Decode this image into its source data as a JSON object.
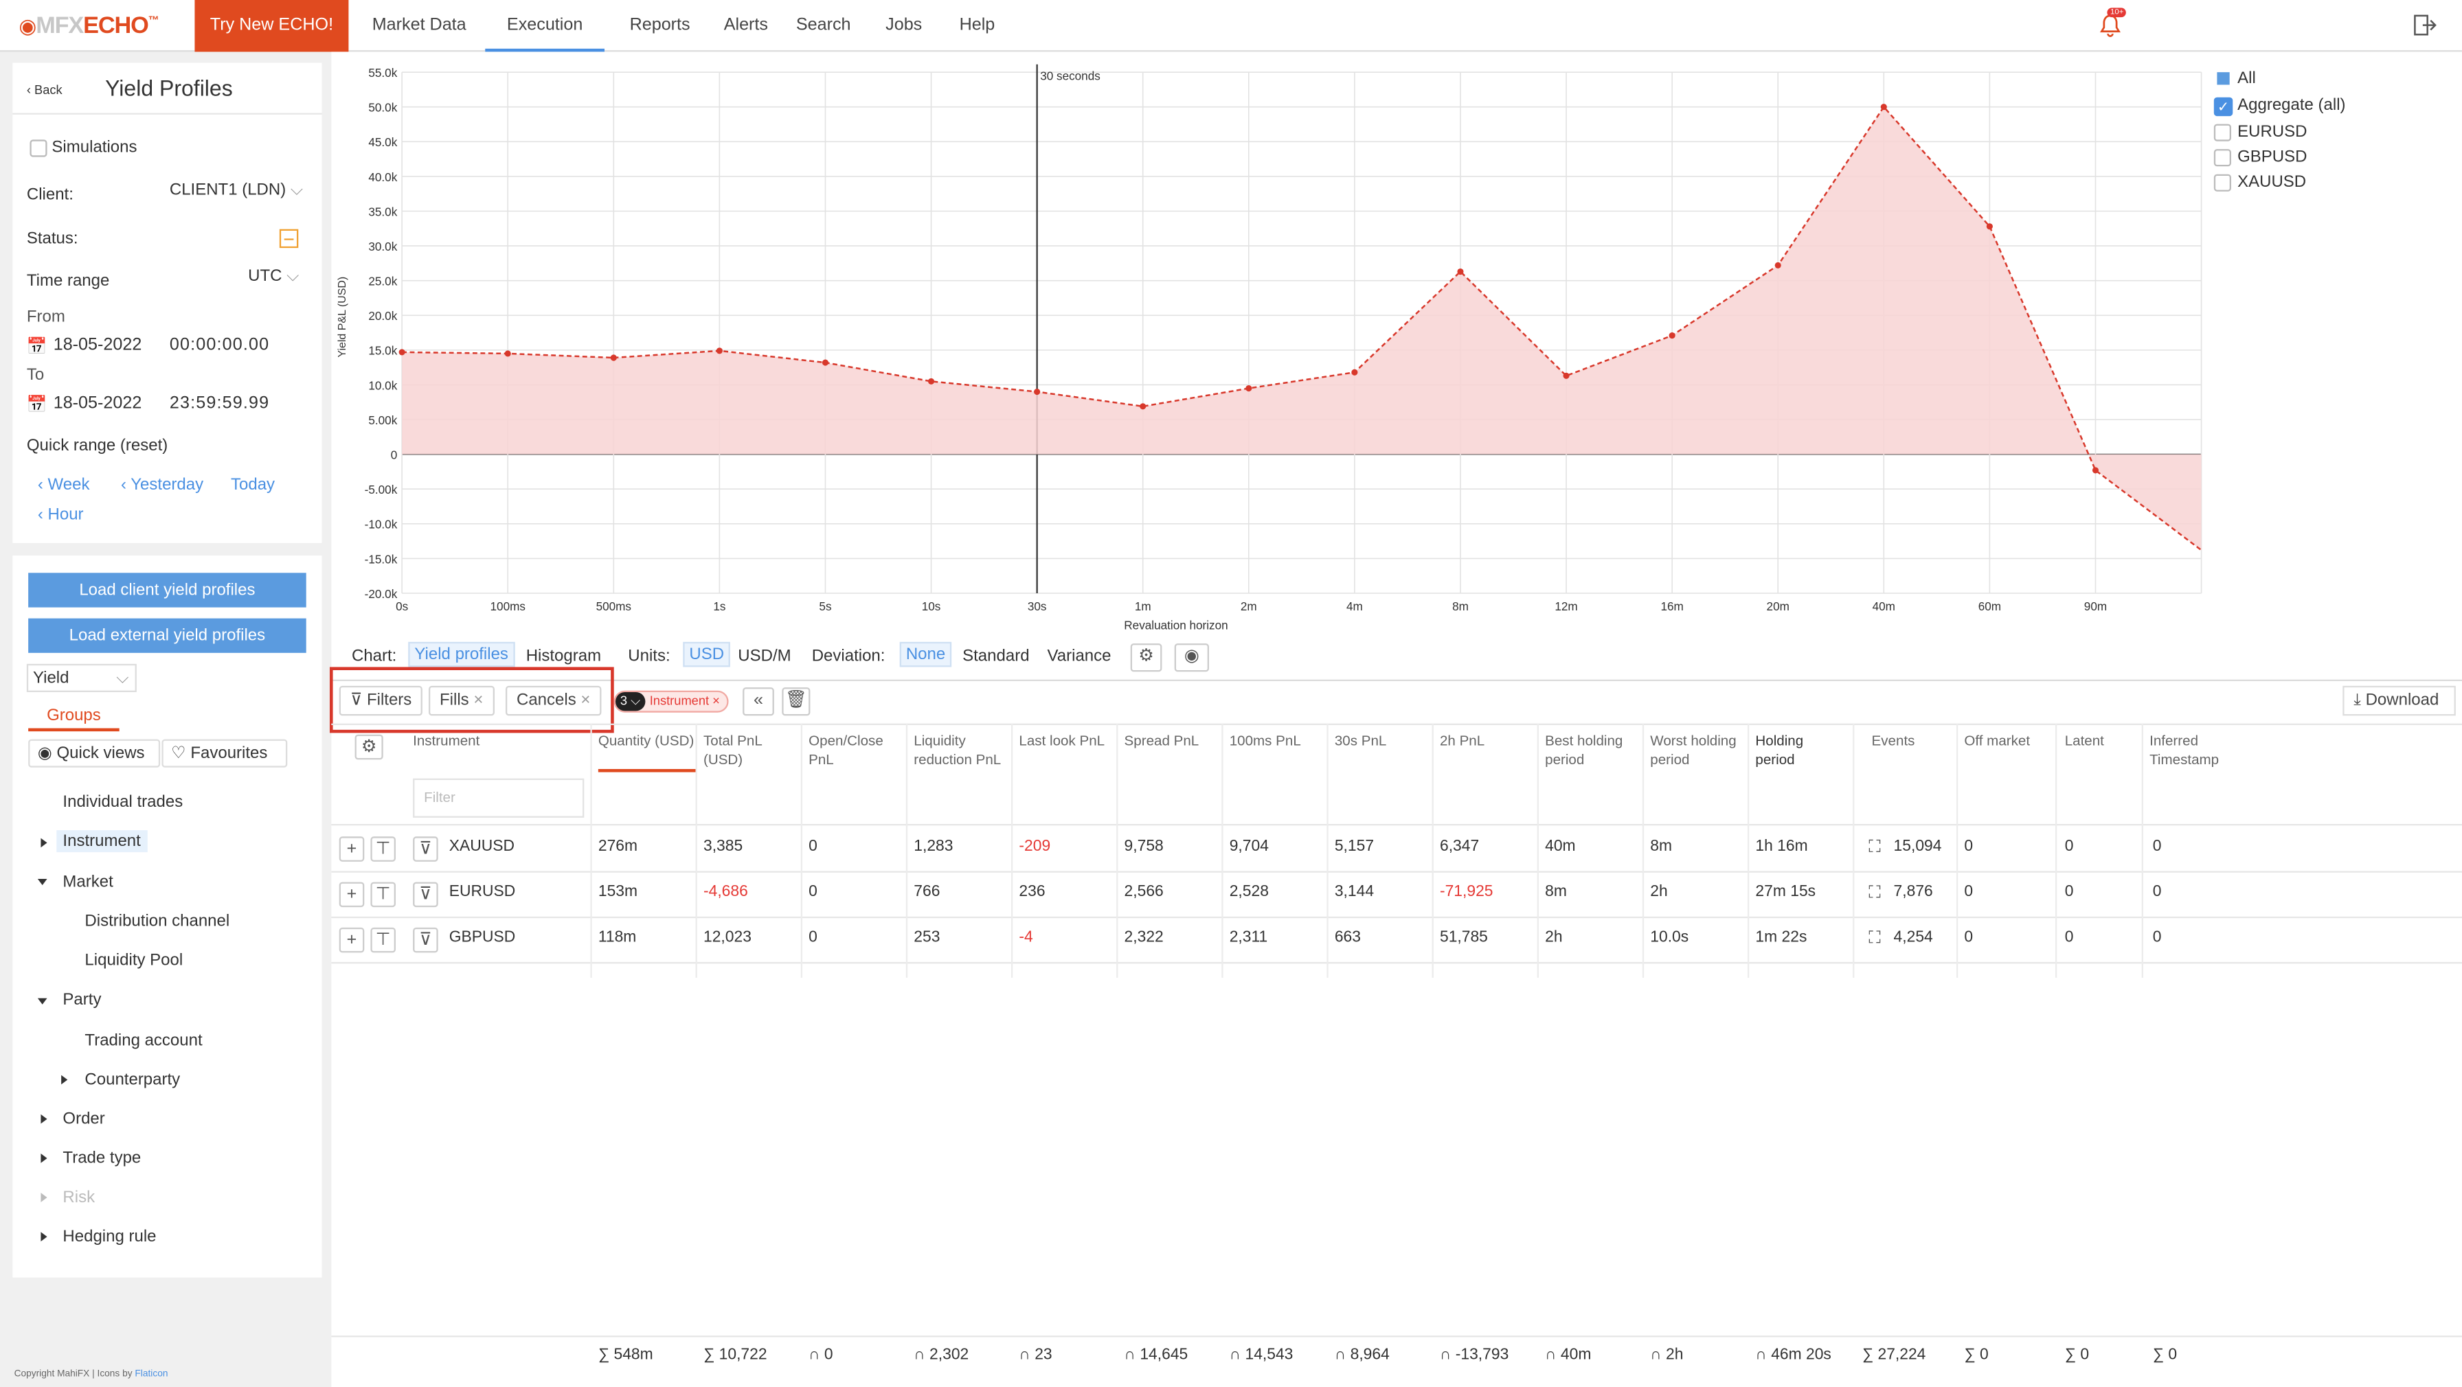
{
  "nav": {
    "logo_prefix": "MFX",
    "logo_main": "ECHO",
    "logo_tm": "™",
    "try_label": "Try New ECHO!",
    "items": [
      "Market Data",
      "Execution",
      "Reports",
      "Alerts",
      "Search",
      "Jobs",
      "Help"
    ],
    "active": "Execution",
    "bell_badge": "10+"
  },
  "sidebar": {
    "back": "Back",
    "title": "Yield Profiles",
    "simulations": "Simulations",
    "client_label": "Client:",
    "client_value": "CLIENT1 (LDN)",
    "status_label": "Status:",
    "time_range_label": "Time range",
    "tz": "UTC",
    "from_label": "From",
    "from_date": "18-05-2022",
    "from_time": "00:00:00.00",
    "to_label": "To",
    "to_date": "18-05-2022",
    "to_time": "23:59:59.99",
    "quick_range": "Quick range (reset)",
    "quick": [
      "Week",
      "Yesterday",
      "Today",
      "Hour"
    ],
    "load_client": "Load client yield profiles",
    "load_external": "Load external yield profiles",
    "yield_select": "Yield",
    "groups_tab": "Groups",
    "quick_views": "Quick views",
    "favourites": "Favourites",
    "groups": [
      "Individual trades",
      "Instrument",
      "Market",
      "Distribution channel",
      "Liquidity Pool",
      "Party",
      "Trading account",
      "Counterparty",
      "Order",
      "Trade type",
      "Risk",
      "Hedging rule"
    ],
    "copyright": "Copyright MahiFX | Icons by",
    "flaticon": "Flaticon"
  },
  "chart_controls": {
    "chart_label": "Chart:",
    "yield_profiles": "Yield profiles",
    "histogram": "Histogram",
    "units_label": "Units:",
    "usd": "USD",
    "usdm": "USD/M",
    "deviation_label": "Deviation:",
    "none": "None",
    "standard": "Standard",
    "variance": "Variance"
  },
  "legend": {
    "all": "All",
    "aggregate": "Aggregate (all)",
    "items": [
      "EURUSD",
      "GBPUSD",
      "XAUUSD"
    ]
  },
  "chart_data": {
    "type": "area",
    "title": "",
    "xlabel": "Revaluation horizon",
    "ylabel": "Yield P&L (USD)",
    "x": [
      "0s",
      "100ms",
      "500ms",
      "1s",
      "5s",
      "10s",
      "30s",
      "1m",
      "2m",
      "4m",
      "8m",
      "12m",
      "16m",
      "20m",
      "40m",
      "60m",
      "90m"
    ],
    "ylim": [
      -20000,
      55000
    ],
    "yticks": [
      "55.0k",
      "50.0k",
      "45.0k",
      "40.0k",
      "35.0k",
      "30.0k",
      "25.0k",
      "20.0k",
      "15.0k",
      "10.0k",
      "5.00k",
      "0",
      "-5.00k",
      "-10.0k",
      "-15.0k",
      "-20.0k"
    ],
    "series": [
      {
        "name": "Aggregate (all)",
        "values": [
          14700,
          14500,
          13900,
          14900,
          13200,
          10500,
          9000,
          6900,
          9500,
          11800,
          26300,
          11300,
          17100,
          27200,
          50000,
          32800,
          -2300,
          -13793
        ]
      }
    ],
    "marker": {
      "x": "30s",
      "label": "30 seconds"
    },
    "grid": true,
    "legend": "top-right"
  },
  "toolbar": {
    "filters": "Filters",
    "fills": "Fills",
    "cancels": "Cancels",
    "badge_count": "3",
    "instrument_chip": "Instrument",
    "download": "Download"
  },
  "table": {
    "headers": [
      "Instrument",
      "Quantity (USD)",
      "Total PnL (USD)",
      "Open/Close PnL",
      "Liquidity reduction PnL",
      "Last look PnL",
      "Spread PnL",
      "100ms PnL",
      "30s PnL",
      "2h PnL",
      "Best holding period",
      "Worst holding period",
      "Holding period",
      "Events",
      "Off market",
      "Latent",
      "Inferred Timestamp"
    ],
    "filter_placeholder": "Filter",
    "rows": [
      [
        "XAUUSD",
        "276m",
        "3,385",
        "0",
        "1,283",
        "-209",
        "9,758",
        "9,704",
        "5,157",
        "6,347",
        "40m",
        "8m",
        "1h 16m",
        "15,094",
        "0",
        "0",
        "0"
      ],
      [
        "EURUSD",
        "153m",
        "-4,686",
        "0",
        "766",
        "236",
        "2,566",
        "2,528",
        "3,144",
        "-71,925",
        "8m",
        "2h",
        "27m 15s",
        "7,876",
        "0",
        "0",
        "0"
      ],
      [
        "GBPUSD",
        "118m",
        "12,023",
        "0",
        "253",
        "-4",
        "2,322",
        "2,311",
        "663",
        "51,785",
        "2h",
        "10.0s",
        "1m 22s",
        "4,254",
        "0",
        "0",
        "0"
      ]
    ],
    "footer": [
      "∑ 548m",
      "∑ 10,722",
      "∩ 0",
      "∩ 2,302",
      "∩ 23",
      "∩ 14,645",
      "∩ 14,543",
      "∩ 8,964",
      "∩ -13,793",
      "∩ 40m",
      "∩ 2h",
      "∩ 46m 20s",
      "∑ 27,224",
      "∑ 0",
      "∑ 0",
      "∑ 0"
    ]
  }
}
